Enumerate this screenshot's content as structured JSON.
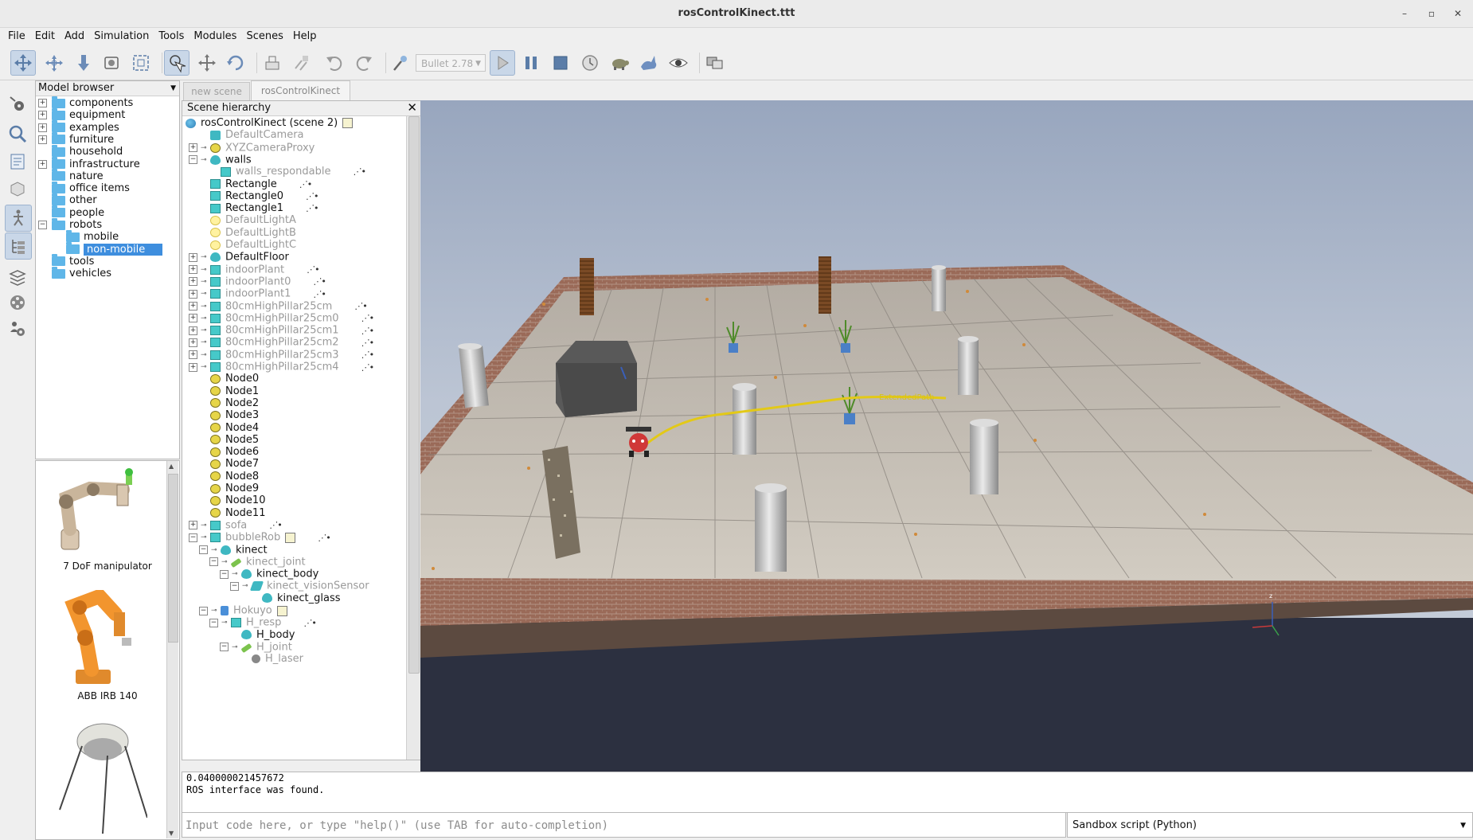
{
  "window": {
    "title": "rosControlKinect.ttt",
    "minimize": "–",
    "restore": "▫",
    "close": "✕"
  },
  "menu": [
    "File",
    "Edit",
    "Add",
    "Simulation",
    "Tools",
    "Modules",
    "Scenes",
    "Help"
  ],
  "toolbar": {
    "physics_engine": "Bullet 2.78",
    "buttons": [
      "camera-pan-icon",
      "camera-rotate-icon",
      "camera-shift-icon",
      "camera-angle-icon",
      "fit-to-view-icon",
      "click-select-icon",
      "object-shift-icon",
      "object-rotate-icon",
      "assemble-icon",
      "transfer-dna-icon",
      "undo-icon",
      "redo-icon",
      "physics-engine-icon",
      "play-icon",
      "pause-icon",
      "stop-icon",
      "real-time-icon",
      "slow-down-icon",
      "speed-up-icon",
      "visualization-icon",
      "page-selector-icon"
    ]
  },
  "left_strip": [
    "simulation-settings-icon",
    "zoom-icon",
    "scripts-icon",
    "shape-edit-icon",
    "model-browser-icon",
    "scene-hierarchy-icon",
    "layers-icon",
    "video-recorder-icon",
    "user-settings-icon"
  ],
  "model_browser": {
    "title": "Model browser",
    "items": [
      {
        "label": "components",
        "expander": "+",
        "depth": 0
      },
      {
        "label": "equipment",
        "expander": "+",
        "depth": 0
      },
      {
        "label": "examples",
        "expander": "+",
        "depth": 0
      },
      {
        "label": "furniture",
        "expander": "+",
        "depth": 0
      },
      {
        "label": "household",
        "expander": "",
        "depth": 0
      },
      {
        "label": "infrastructure",
        "expander": "+",
        "depth": 0
      },
      {
        "label": "nature",
        "expander": "",
        "depth": 0
      },
      {
        "label": "office items",
        "expander": "",
        "depth": 0
      },
      {
        "label": "other",
        "expander": "",
        "depth": 0
      },
      {
        "label": "people",
        "expander": "",
        "depth": 0
      },
      {
        "label": "robots",
        "expander": "−",
        "depth": 0
      },
      {
        "label": "mobile",
        "expander": "",
        "depth": 1
      },
      {
        "label": "non-mobile",
        "expander": "",
        "depth": 1,
        "selected": true
      },
      {
        "label": "tools",
        "expander": "",
        "depth": 0
      },
      {
        "label": "vehicles",
        "expander": "",
        "depth": 0
      }
    ],
    "thumbnails": [
      "7 DoF manipulator",
      "ABB IRB 140",
      ""
    ]
  },
  "tabs": [
    {
      "label": "new scene",
      "active": false
    },
    {
      "label": "rosControlKinect",
      "active": true
    }
  ],
  "scene_hierarchy": {
    "title": "Scene hierarchy",
    "close": "✕",
    "nodes": [
      {
        "label": "rosControlKinect (scene 2)",
        "icon": "scene",
        "depth": 0,
        "dim": false,
        "tag": true
      },
      {
        "label": "DefaultCamera",
        "icon": "cam",
        "depth": 1,
        "dim": true
      },
      {
        "label": "XYZCameraProxy",
        "icon": "dummy",
        "depth": 1,
        "dim": true,
        "exp": "+"
      },
      {
        "label": "walls",
        "icon": "drop",
        "depth": 1,
        "dim": false,
        "exp": "−"
      },
      {
        "label": "walls_respondable",
        "icon": "shape",
        "depth": 2,
        "dim": true,
        "script": true
      },
      {
        "label": "Rectangle",
        "icon": "shape",
        "depth": 1,
        "dim": false,
        "script": true
      },
      {
        "label": "Rectangle0",
        "icon": "shape",
        "depth": 1,
        "dim": false,
        "script": true
      },
      {
        "label": "Rectangle1",
        "icon": "shape",
        "depth": 1,
        "dim": false,
        "script": true
      },
      {
        "label": "DefaultLightA",
        "icon": "light",
        "depth": 1,
        "dim": true
      },
      {
        "label": "DefaultLightB",
        "icon": "light",
        "depth": 1,
        "dim": true
      },
      {
        "label": "DefaultLightC",
        "icon": "light",
        "depth": 1,
        "dim": true
      },
      {
        "label": "DefaultFloor",
        "icon": "drop",
        "depth": 1,
        "dim": false,
        "exp": "+"
      },
      {
        "label": "indoorPlant",
        "icon": "shape",
        "depth": 1,
        "dim": true,
        "exp": "+",
        "script": true
      },
      {
        "label": "indoorPlant0",
        "icon": "shape",
        "depth": 1,
        "dim": true,
        "exp": "+",
        "script": true
      },
      {
        "label": "indoorPlant1",
        "icon": "shape",
        "depth": 1,
        "dim": true,
        "exp": "+",
        "script": true
      },
      {
        "label": "80cmHighPillar25cm",
        "icon": "shape",
        "depth": 1,
        "dim": true,
        "exp": "+",
        "script": true
      },
      {
        "label": "80cmHighPillar25cm0",
        "icon": "shape",
        "depth": 1,
        "dim": true,
        "exp": "+",
        "script": true
      },
      {
        "label": "80cmHighPillar25cm1",
        "icon": "shape",
        "depth": 1,
        "dim": true,
        "exp": "+",
        "script": true
      },
      {
        "label": "80cmHighPillar25cm2",
        "icon": "shape",
        "depth": 1,
        "dim": true,
        "exp": "+",
        "script": true
      },
      {
        "label": "80cmHighPillar25cm3",
        "icon": "shape",
        "depth": 1,
        "dim": true,
        "exp": "+",
        "script": true
      },
      {
        "label": "80cmHighPillar25cm4",
        "icon": "shape",
        "depth": 1,
        "dim": true,
        "exp": "+",
        "script": true
      },
      {
        "label": "Node0",
        "icon": "dummy",
        "depth": 1,
        "dim": false
      },
      {
        "label": "Node1",
        "icon": "dummy",
        "depth": 1,
        "dim": false
      },
      {
        "label": "Node2",
        "icon": "dummy",
        "depth": 1,
        "dim": false
      },
      {
        "label": "Node3",
        "icon": "dummy",
        "depth": 1,
        "dim": false
      },
      {
        "label": "Node4",
        "icon": "dummy",
        "depth": 1,
        "dim": false
      },
      {
        "label": "Node5",
        "icon": "dummy",
        "depth": 1,
        "dim": false
      },
      {
        "label": "Node6",
        "icon": "dummy",
        "depth": 1,
        "dim": false
      },
      {
        "label": "Node7",
        "icon": "dummy",
        "depth": 1,
        "dim": false
      },
      {
        "label": "Node8",
        "icon": "dummy",
        "depth": 1,
        "dim": false
      },
      {
        "label": "Node9",
        "icon": "dummy",
        "depth": 1,
        "dim": false
      },
      {
        "label": "Node10",
        "icon": "dummy",
        "depth": 1,
        "dim": false
      },
      {
        "label": "Node11",
        "icon": "dummy",
        "depth": 1,
        "dim": false
      },
      {
        "label": "sofa",
        "icon": "shape",
        "depth": 1,
        "dim": true,
        "exp": "+",
        "script": true
      },
      {
        "label": "bubbleRob",
        "icon": "shape",
        "depth": 1,
        "dim": true,
        "exp": "−",
        "script": true,
        "tag": true
      },
      {
        "label": "kinect",
        "icon": "drop",
        "depth": 2,
        "dim": false,
        "exp": "−"
      },
      {
        "label": "kinect_joint",
        "icon": "joint",
        "depth": 3,
        "dim": true,
        "exp": "−"
      },
      {
        "label": "kinect_body",
        "icon": "drop",
        "depth": 4,
        "dim": false,
        "exp": "−"
      },
      {
        "label": "kinect_visionSensor",
        "icon": "sensor",
        "depth": 5,
        "dim": true,
        "exp": "−"
      },
      {
        "label": "kinect_glass",
        "icon": "drop",
        "depth": 6,
        "dim": false
      },
      {
        "label": "Hokuyo",
        "icon": "hokuyo",
        "depth": 2,
        "dim": true,
        "exp": "−",
        "tag": true
      },
      {
        "label": "H_resp",
        "icon": "shape",
        "depth": 3,
        "dim": true,
        "exp": "−",
        "script": true
      },
      {
        "label": "H_body",
        "icon": "drop",
        "depth": 4,
        "dim": false
      },
      {
        "label": "H_joint",
        "icon": "joint",
        "depth": 4,
        "dim": true,
        "exp": "−"
      },
      {
        "label": "H_laser",
        "icon": "laser",
        "depth": 5,
        "dim": true
      }
    ]
  },
  "viewport": {
    "path_label": "ExtendedPath"
  },
  "console": {
    "lines": [
      "0.040000021457672",
      "ROS interface was found."
    ],
    "input_placeholder": "Input code here, or type \"help()\" (use TAB for auto-completion)",
    "script_mode": "Sandbox script (Python)"
  },
  "colors": {
    "selection": "#3e8ede",
    "folder": "#5fb6e8",
    "path": "#e3c917"
  }
}
